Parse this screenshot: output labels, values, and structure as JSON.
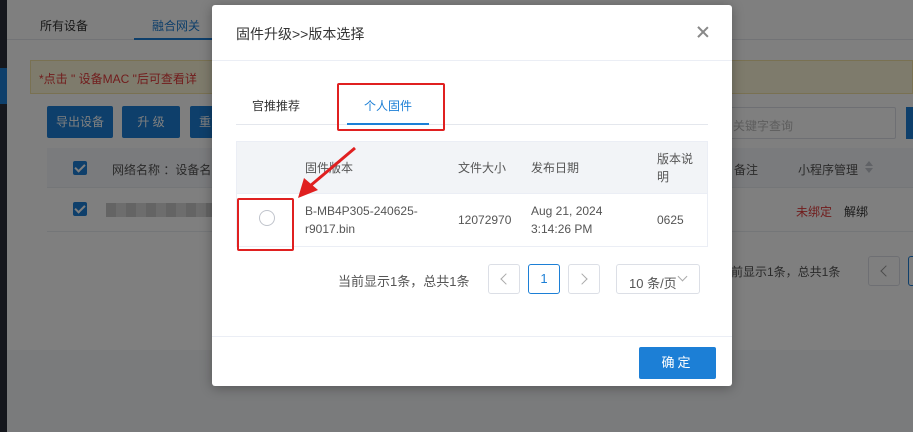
{
  "background": {
    "tabs": [
      "所有设备",
      "融合网关"
    ],
    "notice": "*点击 \" 设备MAC \"后可查看详",
    "buttons": [
      "导出设备",
      "升 级",
      "重"
    ],
    "search_placeholder": "关键字查询",
    "table_headers": {
      "name": "网络名称 ：设备名",
      "remark": "备注",
      "mini_program": "小程序管理"
    },
    "row": {
      "status": "未绑定",
      "unbind": "解绑"
    },
    "pager_text": "前显示1条，总共1条"
  },
  "modal": {
    "title": "固件升级>>版本选择",
    "tabs": {
      "recommended": "官推推荐",
      "personal": "个人固件"
    },
    "table": {
      "headers": {
        "version": "固件版本",
        "size": "文件大小",
        "date": "发布日期",
        "desc": "版本说明"
      },
      "rows": [
        {
          "version": "B-MB4P305-240625-r9017.bin",
          "size": "12072970",
          "date": "Aug 21, 2024 3:14:26 PM",
          "desc": "0625"
        }
      ]
    },
    "pager": {
      "text": "当前显示1条，总共1条",
      "page": "1",
      "page_size": "10 条/页"
    },
    "confirm": "确定"
  },
  "colors": {
    "primary": "#1c7fd6",
    "danger": "#e02020",
    "notice_bg": "#fdf6d9"
  }
}
